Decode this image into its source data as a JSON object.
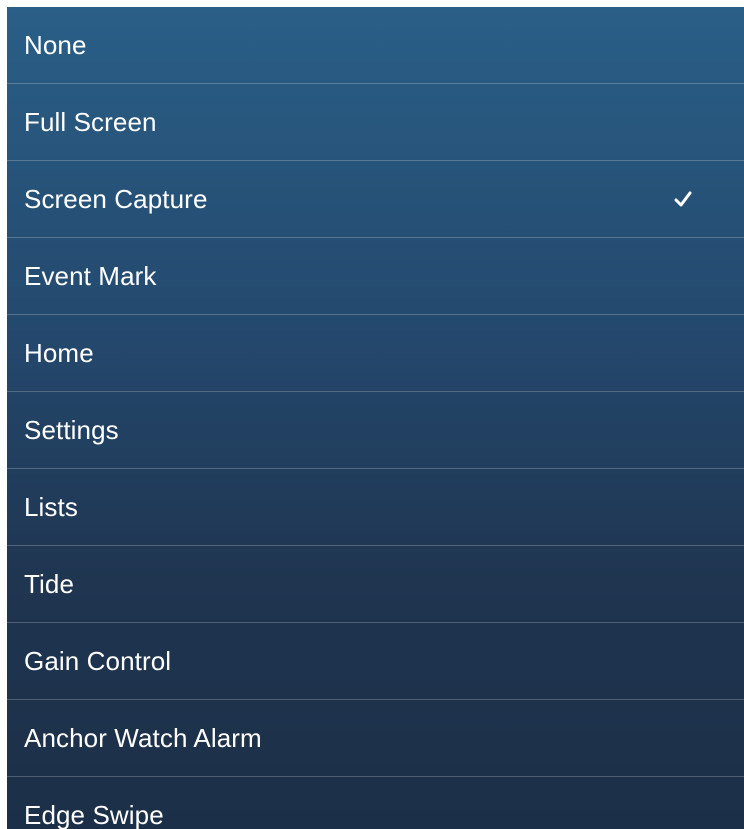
{
  "menu": {
    "items": [
      {
        "label": "None",
        "selected": false
      },
      {
        "label": "Full Screen",
        "selected": false
      },
      {
        "label": "Screen Capture",
        "selected": true
      },
      {
        "label": "Event Mark",
        "selected": false
      },
      {
        "label": "Home",
        "selected": false
      },
      {
        "label": "Settings",
        "selected": false
      },
      {
        "label": "Lists",
        "selected": false
      },
      {
        "label": "Tide",
        "selected": false
      },
      {
        "label": "Gain Control",
        "selected": false
      },
      {
        "label": "Anchor Watch Alarm",
        "selected": false
      },
      {
        "label": "Edge Swipe",
        "selected": false
      }
    ]
  },
  "colors": {
    "background_top": "#2a5f87",
    "background_bottom": "#1c2f48",
    "text": "#ffffff",
    "divider": "rgba(255,255,255,0.22)"
  },
  "icons": {
    "selected_marker": "checkmark-icon"
  }
}
